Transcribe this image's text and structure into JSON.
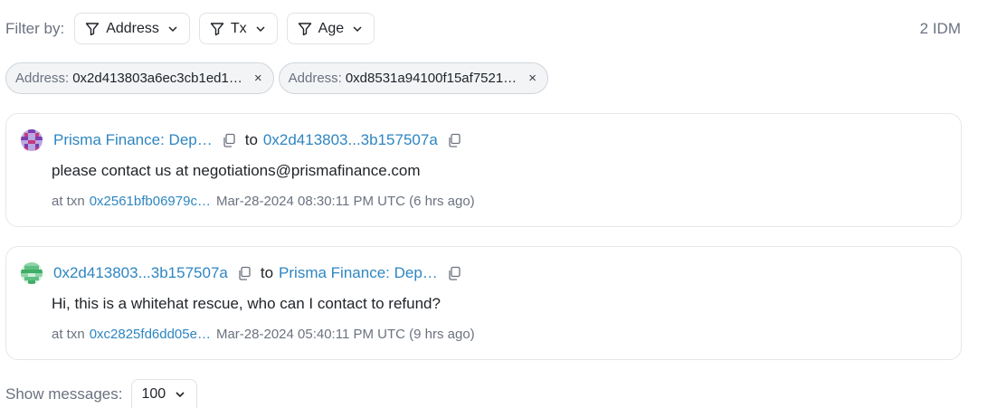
{
  "filter": {
    "label": "Filter by:",
    "buttons": [
      {
        "label": "Address",
        "icon": "funnel-icon"
      },
      {
        "label": "Tx",
        "icon": "funnel-icon"
      },
      {
        "label": "Age",
        "icon": "funnel-icon"
      }
    ],
    "count": "2 IDM"
  },
  "chips": [
    {
      "key": "Address:",
      "value": "0x2d413803a6ec3cb1ed1…",
      "close": "×"
    },
    {
      "key": "Address:",
      "value": "0xd8531a94100f15af7521…",
      "close": "×"
    }
  ],
  "messages": [
    {
      "from": "Prisma Finance: Dep…",
      "to_word": "to",
      "to": "0x2d413803...3b157507a",
      "text": "please contact us at negotiations@prismafinance.com",
      "at_txn_label": "at txn",
      "txn": "0x2561bfb06979c…",
      "time": "Mar-28-2024 08:30:11 PM UTC (6 hrs ago)"
    },
    {
      "from": "0x2d413803...3b157507a",
      "to_word": "to",
      "to": "Prisma Finance: Dep…",
      "text": "Hi, this is a whitehat rescue, who can I contact to refund?",
      "at_txn_label": "at txn",
      "txn": "0xc2825fd6dd05e…",
      "time": "Mar-28-2024 05:40:11 PM UTC (9 hrs ago)"
    }
  ],
  "footer": {
    "label": "Show messages:",
    "page_size": "100"
  },
  "colors": {
    "link": "#2e86c1",
    "muted": "#6b7280",
    "border": "#e4e7eb"
  }
}
